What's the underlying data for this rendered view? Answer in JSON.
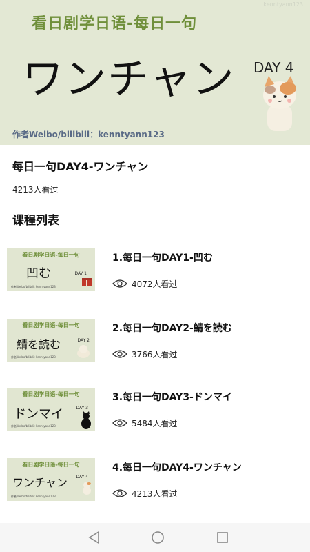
{
  "banner": {
    "subtitle": "看日剧学日语-每日一句",
    "big_text": "ワンチャン",
    "day": "DAY 4",
    "author": "作者Weibo/bilibili：kenntyann123",
    "watermark": "kenntyann123"
  },
  "episode": {
    "title": "每日一句DAY4-ワンチャン",
    "views": "4213人看过"
  },
  "section_title": "课程列表",
  "courses": [
    {
      "title": "1.每日一句DAY1-凹む",
      "views": "4072人看过",
      "thumb_subtitle": "看日剧学日语-每日一句",
      "thumb_text": "凹む",
      "thumb_day": "DAY 1",
      "thumb_author": "作者Weibo/bilibili: kenntyann123"
    },
    {
      "title": "2.每日一句DAY2-鯖を読む",
      "views": "3766人看过",
      "thumb_subtitle": "看日剧学日语-每日一句",
      "thumb_text": "鯖を読む",
      "thumb_day": "DAY 2",
      "thumb_author": "作者Weibo/bilibili: kenntyann123"
    },
    {
      "title": "3.每日一句DAY3-ドンマイ",
      "views": "5484人看过",
      "thumb_subtitle": "看日剧学日语-每日一句",
      "thumb_text": "ドンマイ",
      "thumb_day": "DAY 3",
      "thumb_author": "作者Weibo/bilibili: kenntyann123"
    },
    {
      "title": "4.每日一句DAY4-ワンチャン",
      "views": "4213人看过",
      "thumb_subtitle": "看日剧学日语-每日一句",
      "thumb_text": "ワンチャン",
      "thumb_day": "DAY 4",
      "thumb_author": "作者Weibo/bilibili: kenntyann123"
    }
  ],
  "icons": {
    "views": "eye-icon",
    "back": "back-triangle-icon",
    "home": "home-circle-icon",
    "recents": "recents-square-icon"
  },
  "colors": {
    "banner_bg": "#e3e8d4",
    "banner_subtitle": "#6f8f3a",
    "author_text": "#5a6b86"
  }
}
